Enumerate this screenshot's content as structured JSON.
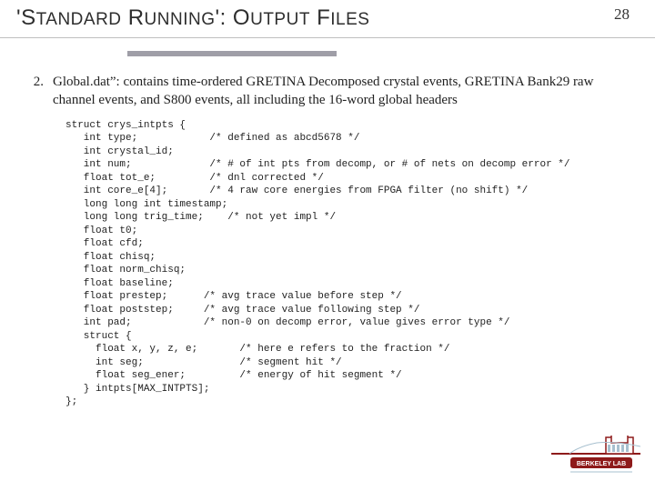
{
  "header": {
    "title_html": "'STANDARD RUNNING': OUTPUT FILES",
    "page_number": "28"
  },
  "item": {
    "number": "2.",
    "text": "Global.dat”: contains time-ordered GRETINA Decomposed crystal events, GRETINA Bank29 raw channel events, and S800 events, all including the 16-word global headers"
  },
  "code": "struct crys_intpts {\n   int type;            /* defined as abcd5678 */\n   int crystal_id;\n   int num;             /* # of int pts from decomp, or # of nets on decomp error */\n   float tot_e;         /* dnl corrected */\n   int core_e[4];       /* 4 raw core energies from FPGA filter (no shift) */\n   long long int timestamp;\n   long long trig_time;    /* not yet impl */\n   float t0;\n   float cfd;\n   float chisq;\n   float norm_chisq;\n   float baseline;\n   float prestep;      /* avg trace value before step */\n   float poststep;     /* avg trace value following step */\n   int pad;            /* non-0 on decomp error, value gives error type */\n   struct {\n     float x, y, z, e;       /* here e refers to the fraction */\n     int seg;                /* segment hit */\n     float seg_ener;         /* energy of hit segment */\n   } intpts[MAX_INTPTS];\n};",
  "logo": {
    "label": "BERKELEY LAB"
  }
}
